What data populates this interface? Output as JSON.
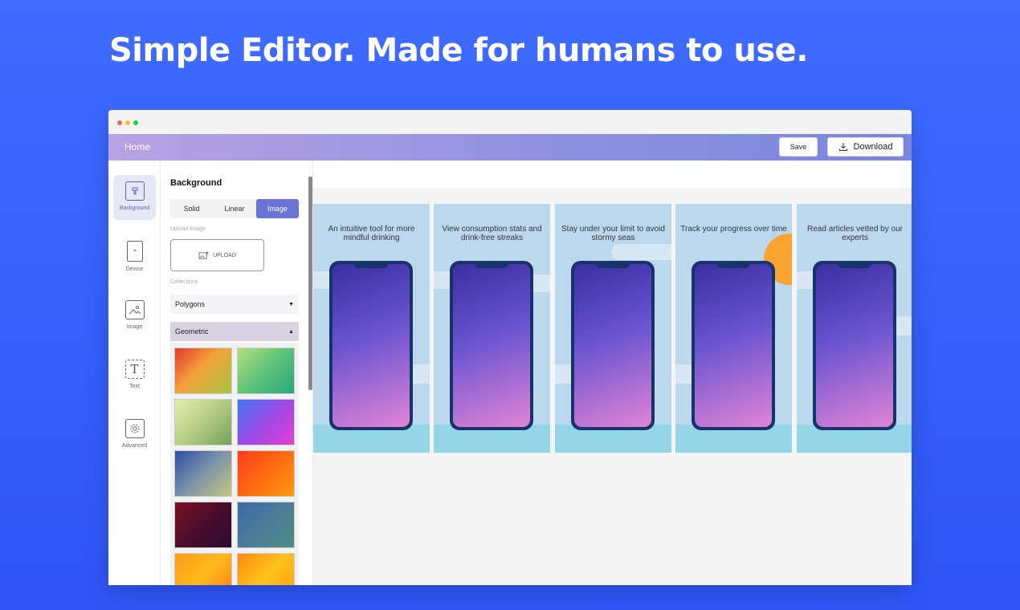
{
  "headline": "Simple Editor. Made for humans to use.",
  "navbar": {
    "home": "Home",
    "save": "Save",
    "download": "Download"
  },
  "rail": {
    "items": [
      {
        "label": "Background",
        "icon": "paint-icon"
      },
      {
        "label": "Device",
        "icon": "device-icon"
      },
      {
        "label": "Image",
        "icon": "image-icon"
      },
      {
        "label": "Text",
        "icon": "text-icon"
      },
      {
        "label": "Advanced",
        "icon": "gear-icon"
      }
    ]
  },
  "panel": {
    "title": "Background",
    "segments": [
      "Solid",
      "Linear",
      "Image"
    ],
    "active_segment": "Image",
    "upload_label": "Upload Image",
    "upload_button": "UPLOAD",
    "collections_label": "Collections",
    "collection_dropdown": "Polygons",
    "subcollection_dropdown": "Geometric"
  },
  "screens": [
    {
      "caption": "An intuitive tool for more mindful drinking"
    },
    {
      "caption": "View consumption stats and drink-free streaks"
    },
    {
      "caption": "Stay under your limit to avoid stormy seas"
    },
    {
      "caption": "Track your progress over time"
    },
    {
      "caption": "Read articles vetted by our experts"
    }
  ],
  "colors": {
    "accent": "#6a74d6",
    "background": "#3f6bff"
  }
}
